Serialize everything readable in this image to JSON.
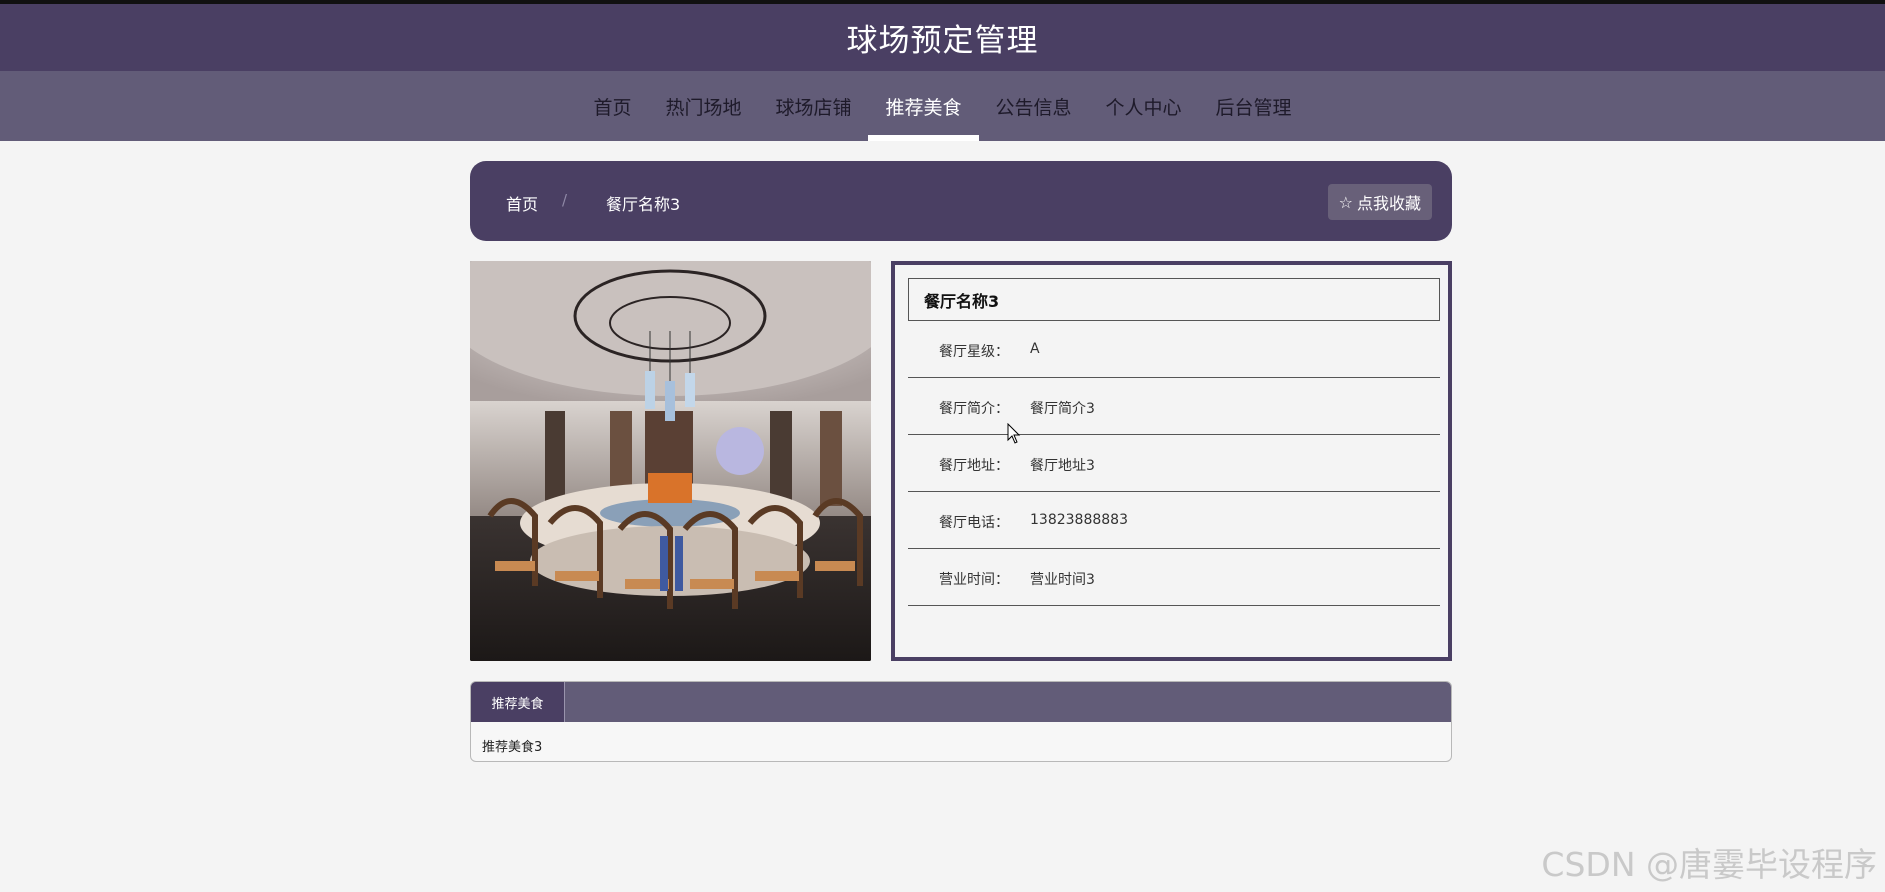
{
  "header": {
    "site_title": "球场预定管理"
  },
  "nav": {
    "items": [
      {
        "label": "首页",
        "active": false
      },
      {
        "label": "热门场地",
        "active": false
      },
      {
        "label": "球场店铺",
        "active": false
      },
      {
        "label": "推荐美食",
        "active": true
      },
      {
        "label": "公告信息",
        "active": false
      },
      {
        "label": "个人中心",
        "active": false
      },
      {
        "label": "后台管理",
        "active": false
      }
    ]
  },
  "breadcrumb": {
    "home": "首页",
    "separator": "/",
    "current": "餐厅名称3"
  },
  "favorite_button": {
    "icon": "star-outline-icon",
    "label": "点我收藏"
  },
  "photo": {
    "alt": "restaurant-dining-room-photo"
  },
  "detail": {
    "name": "餐厅名称3",
    "fields": [
      {
        "label": "餐厅星级：",
        "value": "A"
      },
      {
        "label": "餐厅简介：",
        "value": "餐厅简介3"
      },
      {
        "label": "餐厅地址：",
        "value": "餐厅地址3"
      },
      {
        "label": "餐厅电话：",
        "value": "13823888883"
      },
      {
        "label": "营业时间：",
        "value": "营业时间3"
      }
    ]
  },
  "food_panel": {
    "tab_label": "推荐美食",
    "content": "推荐美食3"
  },
  "watermark": "CSDN @唐霎毕设程序",
  "colors": {
    "header_bg": "#4a3f63",
    "nav_bg": "#625c78",
    "page_bg": "#f4f4f4",
    "accent_white": "#ffffff"
  }
}
